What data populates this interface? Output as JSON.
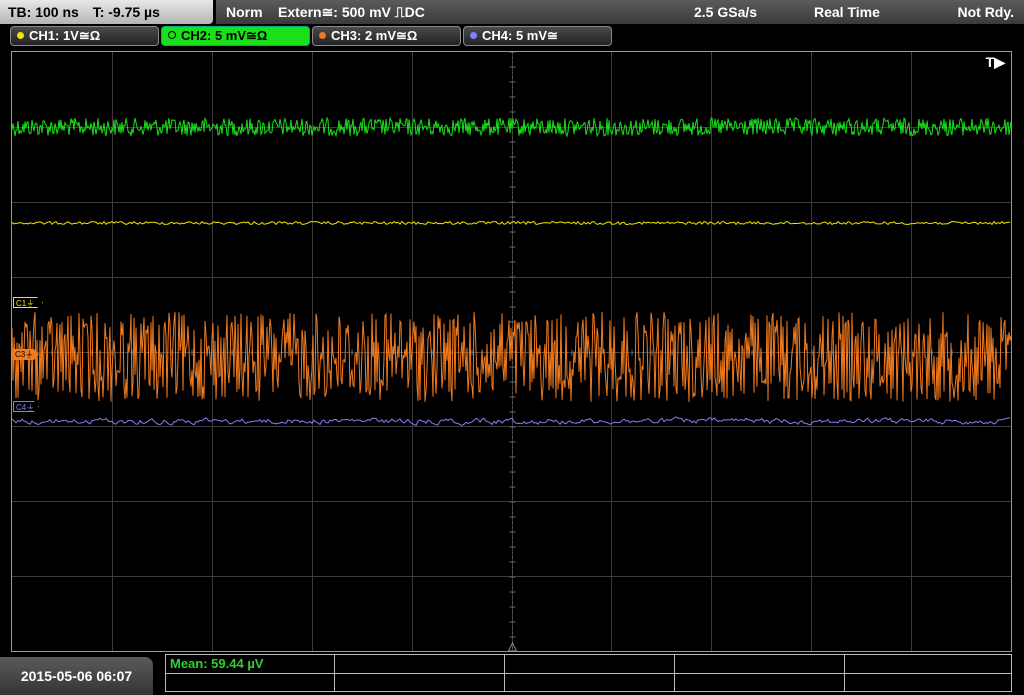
{
  "topbar": {
    "timebase": "TB: 100 ns",
    "trigger_time": "T: -9.75 µs",
    "mode": "Norm",
    "trigger_source": "Extern≅: 500 mV ⎍DC",
    "sample_rate": "2.5 GSa/s",
    "acq_mode": "Real Time",
    "status": "Not Rdy."
  },
  "channels": [
    {
      "label": "CH1: 1V≅Ω",
      "color": "#f2e600",
      "active": false
    },
    {
      "label": "CH2: 5 mV≅Ω",
      "color": "#19e019",
      "active": true
    },
    {
      "label": "CH3: 2 mV≅Ω",
      "color": "#f07a1e",
      "active": false
    },
    {
      "label": "CH4: 5 mV≅",
      "color": "#8080ff",
      "active": false
    }
  ],
  "screen": {
    "trigger_marker": "T▶",
    "markers": {
      "c1": "C1⏚",
      "c3": "C3⏚",
      "c4": "C4⏚"
    }
  },
  "measurement": {
    "label": "Mean: 59.44 µV"
  },
  "timestamp": "2015-05-06 06:07",
  "colors": {
    "ch1": "#f2e600",
    "ch2": "#19e019",
    "ch3": "#f07a1e",
    "ch4": "#8080ff",
    "grid": "#3c3c3c"
  }
}
